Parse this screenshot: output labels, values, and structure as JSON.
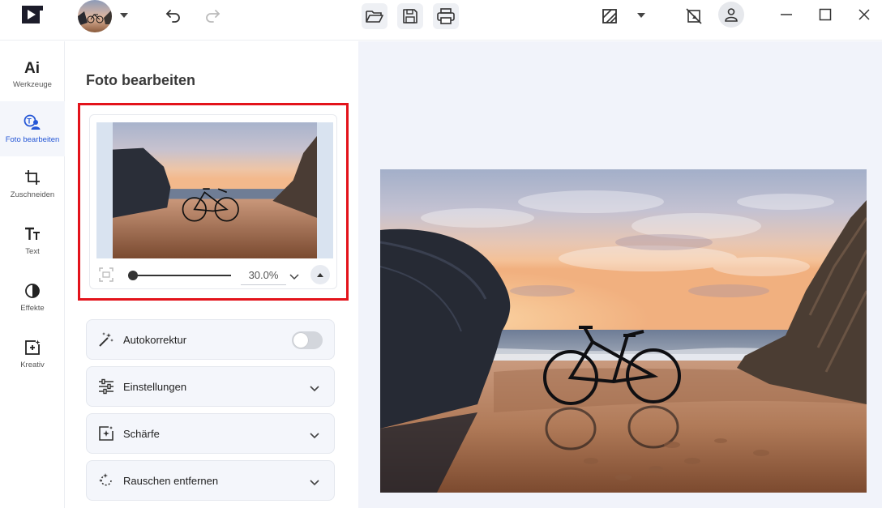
{
  "icons": {
    "logo": "app-logo-icon",
    "undo": "undo-icon",
    "redo": "redo-icon",
    "open": "folder-open-icon",
    "save": "save-icon",
    "print": "print-icon",
    "compare": "compare-icon",
    "nocrop": "crop-off-icon",
    "user": "user-icon"
  },
  "colors": {
    "accent": "#2557d6",
    "highlight": "#e3131b",
    "canvas_bg": "#f1f3fa"
  },
  "nav": {
    "items": [
      {
        "label": "Werkzeuge",
        "icon": "ai-icon"
      },
      {
        "label": "Foto bearbeiten",
        "icon": "photo-edit-icon",
        "active": true
      },
      {
        "label": "Zuschneiden",
        "icon": "crop-icon"
      },
      {
        "label": "Text",
        "icon": "text-icon"
      },
      {
        "label": "Effekte",
        "icon": "effects-icon"
      },
      {
        "label": "Kreativ",
        "icon": "creative-icon"
      }
    ]
  },
  "panel": {
    "title": "Foto bearbeiten",
    "zoom": {
      "value": "30.0%",
      "slider_level": 0
    },
    "sections": [
      {
        "label": "Autokorrektur",
        "icon": "magic-wand-icon",
        "toggle": false
      },
      {
        "label": "Einstellungen",
        "icon": "sliders-icon"
      },
      {
        "label": "Schärfe",
        "icon": "sharpen-icon"
      },
      {
        "label": "Rauschen entfernen",
        "icon": "denoise-icon"
      }
    ]
  }
}
